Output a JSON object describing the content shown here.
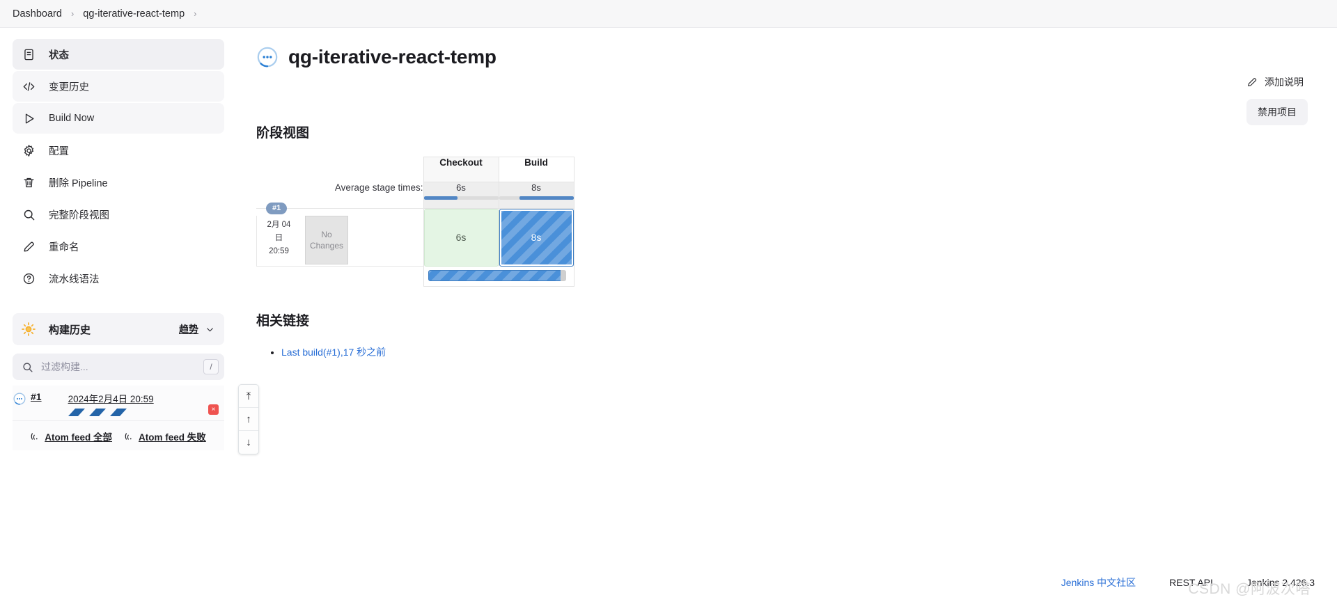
{
  "breadcrumb": {
    "items": [
      {
        "label": "Dashboard"
      },
      {
        "label": "qg-iterative-react-temp"
      }
    ],
    "separator": "›"
  },
  "sidebar": {
    "tasks": [
      {
        "label": "状态",
        "icon": "document-icon",
        "state": "active"
      },
      {
        "label": "变更历史",
        "icon": "code-icon",
        "state": "hover"
      },
      {
        "label": "Build Now",
        "icon": "play-icon",
        "state": "hover"
      },
      {
        "label": "配置",
        "icon": "gear-icon",
        "state": "normal"
      },
      {
        "label": "删除 Pipeline",
        "icon": "trash-icon",
        "state": "normal"
      },
      {
        "label": "完整阶段视图",
        "icon": "search-icon",
        "state": "normal"
      },
      {
        "label": "重命名",
        "icon": "pencil-icon",
        "state": "normal"
      },
      {
        "label": "流水线语法",
        "icon": "help-circle-icon",
        "state": "normal"
      }
    ],
    "build_history": {
      "title": "构建历史",
      "trend_label": "趋势",
      "filter_placeholder": "过滤构建...",
      "filter_value": "",
      "filter_shortcut": "/",
      "builds": [
        {
          "number": "#1",
          "timestamp": "2024年2月4日 20:59",
          "status": "in-progress",
          "delete_label": "×"
        }
      ],
      "feeds": [
        {
          "label": "Atom feed 全部"
        },
        {
          "label": "Atom feed 失败"
        }
      ]
    },
    "scroll_nav": [
      {
        "name": "scroll-to-top",
        "glyph": "⤒"
      },
      {
        "name": "scroll-up",
        "glyph": "↑"
      },
      {
        "name": "scroll-down",
        "glyph": "↓"
      }
    ]
  },
  "header": {
    "title": "qg-iterative-react-temp",
    "status_icon": "in-progress-ball-icon",
    "add_description_label": "添加说明",
    "disable_project_label": "禁用项目"
  },
  "stage_view": {
    "section_title": "阶段视图",
    "average_label": "Average stage times:",
    "stages": [
      {
        "name": "Checkout",
        "average": "6s",
        "bar_percent": 45,
        "bar_align": "left"
      },
      {
        "name": "Build",
        "average": "8s",
        "bar_percent": 72,
        "bar_align": "right"
      }
    ],
    "runs": [
      {
        "badge": "#1",
        "date_line1": "2月 04",
        "date_line2": "日",
        "time": "20:59",
        "changes": "No Changes",
        "cells": [
          {
            "duration": "6s",
            "status": "success"
          },
          {
            "duration": "8s",
            "status": "running"
          }
        ]
      }
    ]
  },
  "related_links": {
    "title": "相关链接",
    "items": [
      {
        "label": "Last build(#1),17 秒之前"
      }
    ]
  },
  "footer": {
    "community_link": "Jenkins 中文社区",
    "rest_api": "REST API",
    "version": "Jenkins 2.426.3",
    "watermark": "CSDN @阿波次嗒"
  },
  "colors": {
    "accent_blue": "#4a90d9",
    "link_blue": "#2a6fd6",
    "success_green": "#e4f5e4",
    "sidebar_active": "#f0f0f3",
    "delete_red": "#ef5350"
  }
}
